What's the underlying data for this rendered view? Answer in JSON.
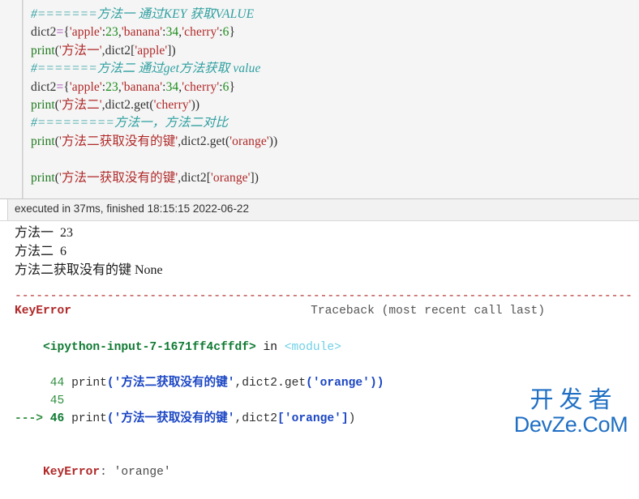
{
  "cell": {
    "lines": [
      {
        "id": "line-1",
        "tokens": [
          {
            "cls": "tok-comment",
            "t": "#=======方法一 通过KEY 获取VALUE"
          }
        ]
      },
      {
        "id": "line-2",
        "tokens": [
          {
            "cls": "tok-plain",
            "t": "dict2"
          },
          {
            "cls": "tok-op",
            "t": "="
          },
          {
            "cls": "tok-brk",
            "t": "{"
          },
          {
            "cls": "tok-str",
            "t": "'apple'"
          },
          {
            "cls": "tok-plain",
            "t": ":"
          },
          {
            "cls": "tok-num",
            "t": "23"
          },
          {
            "cls": "tok-plain",
            "t": ","
          },
          {
            "cls": "tok-str",
            "t": "'banana'"
          },
          {
            "cls": "tok-plain",
            "t": ":"
          },
          {
            "cls": "tok-num",
            "t": "34"
          },
          {
            "cls": "tok-plain",
            "t": ","
          },
          {
            "cls": "tok-str",
            "t": "'cherry'"
          },
          {
            "cls": "tok-plain",
            "t": ":"
          },
          {
            "cls": "tok-num",
            "t": "6"
          },
          {
            "cls": "tok-brk",
            "t": "}"
          }
        ]
      },
      {
        "id": "line-3",
        "tokens": [
          {
            "cls": "tok-builtin",
            "t": "print"
          },
          {
            "cls": "tok-brk",
            "t": "("
          },
          {
            "cls": "tok-str",
            "t": "'方法一'"
          },
          {
            "cls": "tok-plain",
            "t": ","
          },
          {
            "cls": "tok-plain",
            "t": "dict2"
          },
          {
            "cls": "tok-brk",
            "t": "["
          },
          {
            "cls": "tok-str",
            "t": "'apple'"
          },
          {
            "cls": "tok-brk",
            "t": "])"
          }
        ]
      },
      {
        "id": "line-4",
        "tokens": [
          {
            "cls": "tok-comment",
            "t": "#=======方法二 通过get方法获取 value"
          }
        ]
      },
      {
        "id": "line-5",
        "tokens": [
          {
            "cls": "tok-plain",
            "t": "dict2"
          },
          {
            "cls": "tok-op",
            "t": "="
          },
          {
            "cls": "tok-brk",
            "t": "{"
          },
          {
            "cls": "tok-str",
            "t": "'apple'"
          },
          {
            "cls": "tok-plain",
            "t": ":"
          },
          {
            "cls": "tok-num",
            "t": "23"
          },
          {
            "cls": "tok-plain",
            "t": ","
          },
          {
            "cls": "tok-str",
            "t": "'banana'"
          },
          {
            "cls": "tok-plain",
            "t": ":"
          },
          {
            "cls": "tok-num",
            "t": "34"
          },
          {
            "cls": "tok-plain",
            "t": ","
          },
          {
            "cls": "tok-str",
            "t": "'cherry'"
          },
          {
            "cls": "tok-plain",
            "t": ":"
          },
          {
            "cls": "tok-num",
            "t": "6"
          },
          {
            "cls": "tok-brk",
            "t": "}"
          }
        ]
      },
      {
        "id": "line-6",
        "tokens": [
          {
            "cls": "tok-builtin",
            "t": "print"
          },
          {
            "cls": "tok-brk",
            "t": "("
          },
          {
            "cls": "tok-str",
            "t": "'方法二'"
          },
          {
            "cls": "tok-plain",
            "t": ","
          },
          {
            "cls": "tok-plain",
            "t": "dict2."
          },
          {
            "cls": "tok-plain",
            "t": "get"
          },
          {
            "cls": "tok-brk",
            "t": "("
          },
          {
            "cls": "tok-str",
            "t": "'cherry'"
          },
          {
            "cls": "tok-brk",
            "t": "))"
          }
        ]
      },
      {
        "id": "line-7",
        "tokens": [
          {
            "cls": "tok-comment",
            "t": "#=========方法一，方法二对比"
          }
        ]
      },
      {
        "id": "line-8",
        "tokens": [
          {
            "cls": "tok-builtin",
            "t": "print"
          },
          {
            "cls": "tok-brk",
            "t": "("
          },
          {
            "cls": "tok-str",
            "t": "'方法二获取没有的键'"
          },
          {
            "cls": "tok-plain",
            "t": ","
          },
          {
            "cls": "tok-plain",
            "t": "dict2."
          },
          {
            "cls": "tok-plain",
            "t": "get"
          },
          {
            "cls": "tok-brk",
            "t": "("
          },
          {
            "cls": "tok-str",
            "t": "'orange'"
          },
          {
            "cls": "tok-brk",
            "t": "))"
          }
        ]
      },
      {
        "id": "line-9",
        "blank": true,
        "tokens": []
      },
      {
        "id": "line-10",
        "tokens": [
          {
            "cls": "tok-builtin",
            "t": "print"
          },
          {
            "cls": "tok-brk",
            "t": "("
          },
          {
            "cls": "tok-str",
            "t": "'方法一获取没有的键'"
          },
          {
            "cls": "tok-plain",
            "t": ","
          },
          {
            "cls": "tok-plain",
            "t": "dict2"
          },
          {
            "cls": "tok-brk",
            "t": "["
          },
          {
            "cls": "tok-str",
            "t": "'orange'"
          },
          {
            "cls": "tok-brk",
            "t": "])"
          }
        ]
      }
    ]
  },
  "exec_bar": {
    "text": "executed in 37ms, finished 18:15:15 2022-06-22",
    "duration": "37ms",
    "finished_time": "18:15:15",
    "finished_date": "2022-06-22"
  },
  "stdout": {
    "lines": [
      "方法一  23",
      "方法二  6",
      "方法二获取没有的键 None"
    ]
  },
  "traceback": {
    "rule": "---------------------------------------------------------------------------",
    "error_name": "KeyError",
    "trace_label": "Traceback (most recent call last)",
    "location": {
      "file": "<ipython-input-7-1671ff4cffdf>",
      "in_word": " in ",
      "scope": "<module>"
    },
    "frames": [
      {
        "arrow": "",
        "lineno": "44",
        "tokens": [
          {
            "cls": "tb-builtin",
            "t": "print"
          },
          {
            "cls": "tb-str-blue",
            "t": "("
          },
          {
            "cls": "tb-str-blue",
            "t": "'方法二获取没有的键'"
          },
          {
            "cls": "tb-plain",
            "t": ","
          },
          {
            "cls": "tb-plain",
            "t": "dict2."
          },
          {
            "cls": "tb-plain",
            "t": "get"
          },
          {
            "cls": "tb-str-blue",
            "t": "("
          },
          {
            "cls": "tb-str-blue",
            "t": "'orange'"
          },
          {
            "cls": "tb-str-blue",
            "t": "))"
          }
        ]
      },
      {
        "arrow": "",
        "lineno": "45",
        "tokens": []
      },
      {
        "arrow": "---> ",
        "lineno": "46",
        "current": true,
        "tokens": [
          {
            "cls": "tb-builtin",
            "t": "print"
          },
          {
            "cls": "tb-str-blue",
            "t": "("
          },
          {
            "cls": "tb-str-blue",
            "t": "'方法一获取没有的键'"
          },
          {
            "cls": "tb-plain",
            "t": ","
          },
          {
            "cls": "tb-plain",
            "t": "dict2"
          },
          {
            "cls": "tb-str-blue",
            "t": "["
          },
          {
            "cls": "tb-str-blue",
            "t": "'orange'"
          },
          {
            "cls": "tb-str-blue",
            "t": "]"
          },
          {
            "cls": "tb-plain",
            "t": ")"
          }
        ]
      }
    ],
    "final": {
      "name": "KeyError",
      "separator": ": ",
      "value": "'orange'"
    }
  },
  "watermark": {
    "cn": "开发者",
    "en": "DevZe.CoM",
    "color": "#1f6fc4"
  }
}
